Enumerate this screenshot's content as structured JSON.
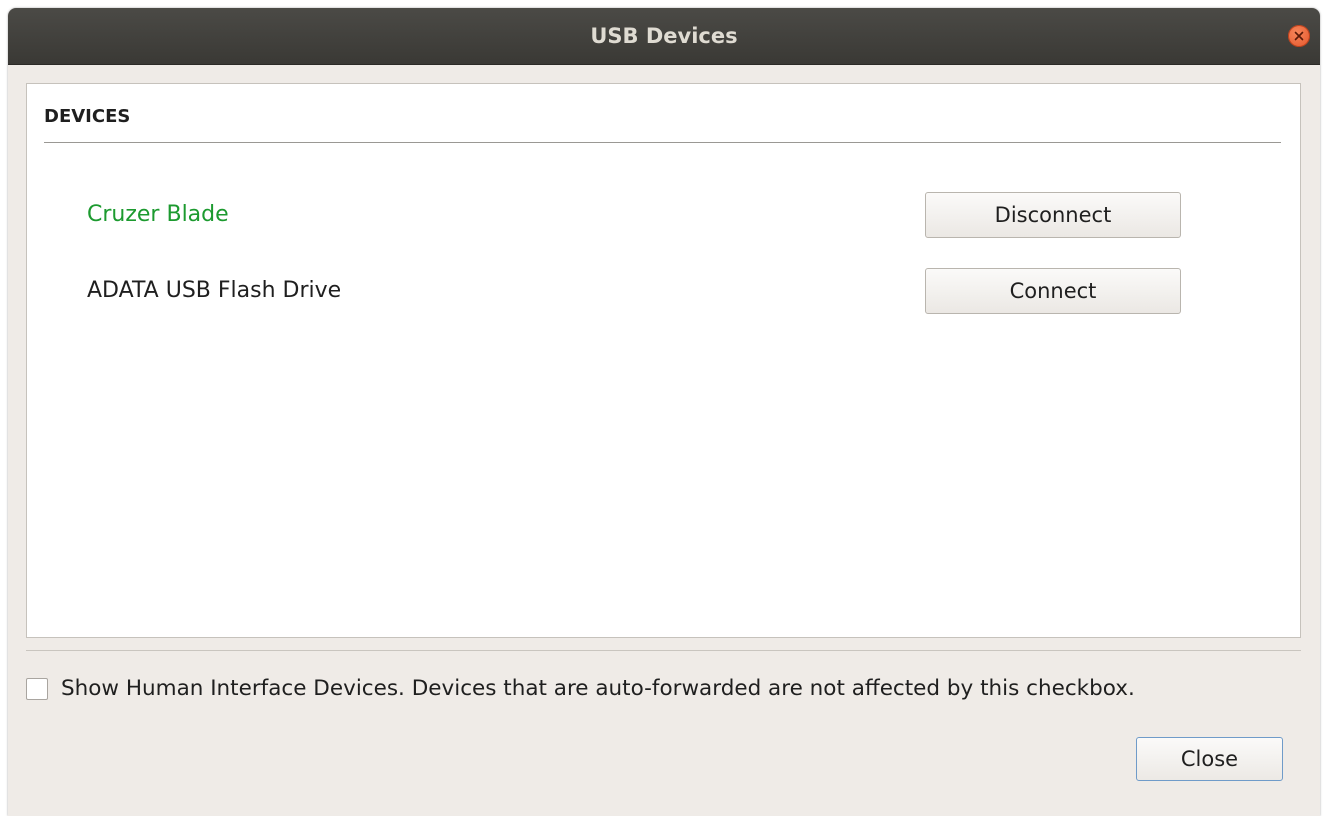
{
  "window": {
    "title": "USB Devices"
  },
  "devices_panel": {
    "heading": "DEVICES",
    "devices": [
      {
        "name": "Cruzer Blade",
        "connected": true,
        "action_label": "Disconnect"
      },
      {
        "name": "ADATA USB Flash Drive",
        "connected": false,
        "action_label": "Connect"
      }
    ]
  },
  "options": {
    "show_hid_label": "Show Human Interface Devices. Devices that are auto-forwarded are not affected by this checkbox.",
    "show_hid_checked": false
  },
  "footer": {
    "close_label": "Close"
  },
  "colors": {
    "connected_text": "#1c9a2f",
    "titlebar": "#3f3e3a",
    "window_bg": "#efebe7",
    "close_button_accent": "#e3542a"
  },
  "icons": {
    "titlebar_close": "close-icon"
  }
}
